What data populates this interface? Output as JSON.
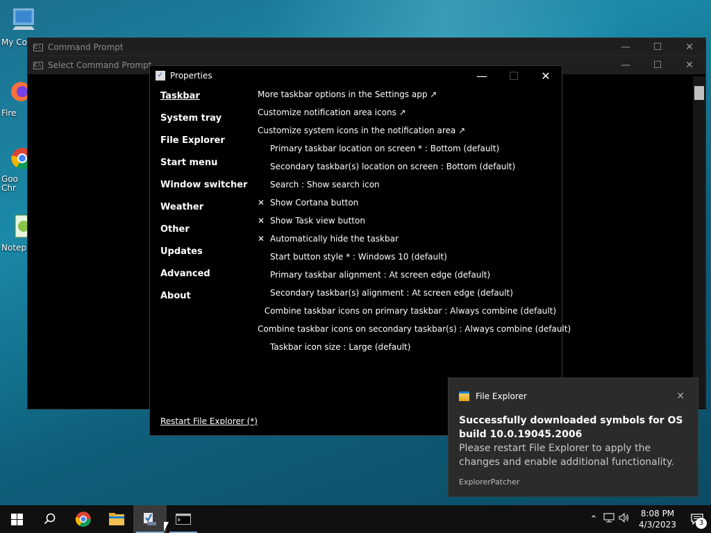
{
  "desktop": {
    "icons": [
      {
        "label": "My Co",
        "icon": "computer-icon"
      },
      {
        "label": "Fire",
        "icon": "firefox-icon"
      },
      {
        "label": "Goo Chr",
        "icon": "chrome-icon"
      },
      {
        "label": "Notep",
        "icon": "notepad-icon"
      }
    ]
  },
  "cmd_windows": [
    {
      "title": "Command Prompt"
    },
    {
      "title": "Select Command Prompt"
    }
  ],
  "properties": {
    "title": "Properties",
    "nav": [
      {
        "label": "Taskbar"
      },
      {
        "label": "System tray"
      },
      {
        "label": "File Explorer"
      },
      {
        "label": "Start menu"
      },
      {
        "label": "Window switcher"
      },
      {
        "label": "Weather"
      },
      {
        "label": "Other"
      },
      {
        "label": "Updates"
      },
      {
        "label": "Advanced"
      },
      {
        "label": "About"
      }
    ],
    "options": [
      {
        "mark": "",
        "label": "More taskbar options in the Settings app ↗"
      },
      {
        "mark": "",
        "label": "Customize notification area icons ↗"
      },
      {
        "mark": "",
        "label": "Customize system icons in the notification area ↗"
      },
      {
        "mark": " ",
        "label": "Primary taskbar location on screen * : Bottom (default)"
      },
      {
        "mark": " ",
        "label": "Secondary taskbar(s) location on screen : Bottom (default)"
      },
      {
        "mark": " ",
        "label": "Search : Show search icon"
      },
      {
        "mark": "✕",
        "label": "Show Cortana button"
      },
      {
        "mark": "✕",
        "label": "Show Task view button"
      },
      {
        "mark": "✕",
        "label": "Automatically hide the taskbar"
      },
      {
        "mark": " ",
        "label": "Start button style * : Windows 10 (default)"
      },
      {
        "mark": " ",
        "label": "Primary taskbar alignment : At screen edge (default)"
      },
      {
        "mark": " ",
        "label": "Secondary taskbar(s) alignment : At screen edge (default)"
      },
      {
        "mark": " ",
        "label": "Combine taskbar icons on primary taskbar : Always combine (default)"
      },
      {
        "mark": " ",
        "label": "Combine taskbar icons on secondary taskbar(s) : Always combine (default)"
      },
      {
        "mark": " ",
        "label": "Taskbar icon size : Large (default)"
      }
    ],
    "restart_label": "Restart File Explorer (*)"
  },
  "toast": {
    "app": "File Explorer",
    "title": "Successfully downloaded symbols for OS build 10.0.19045.2006",
    "body": "Please restart File Explorer to apply the changes and enable additional functionality.",
    "source": "ExplorerPatcher"
  },
  "taskbar": {
    "time": "8:08 PM",
    "date": "4/3/2023",
    "notification_count": "3"
  }
}
